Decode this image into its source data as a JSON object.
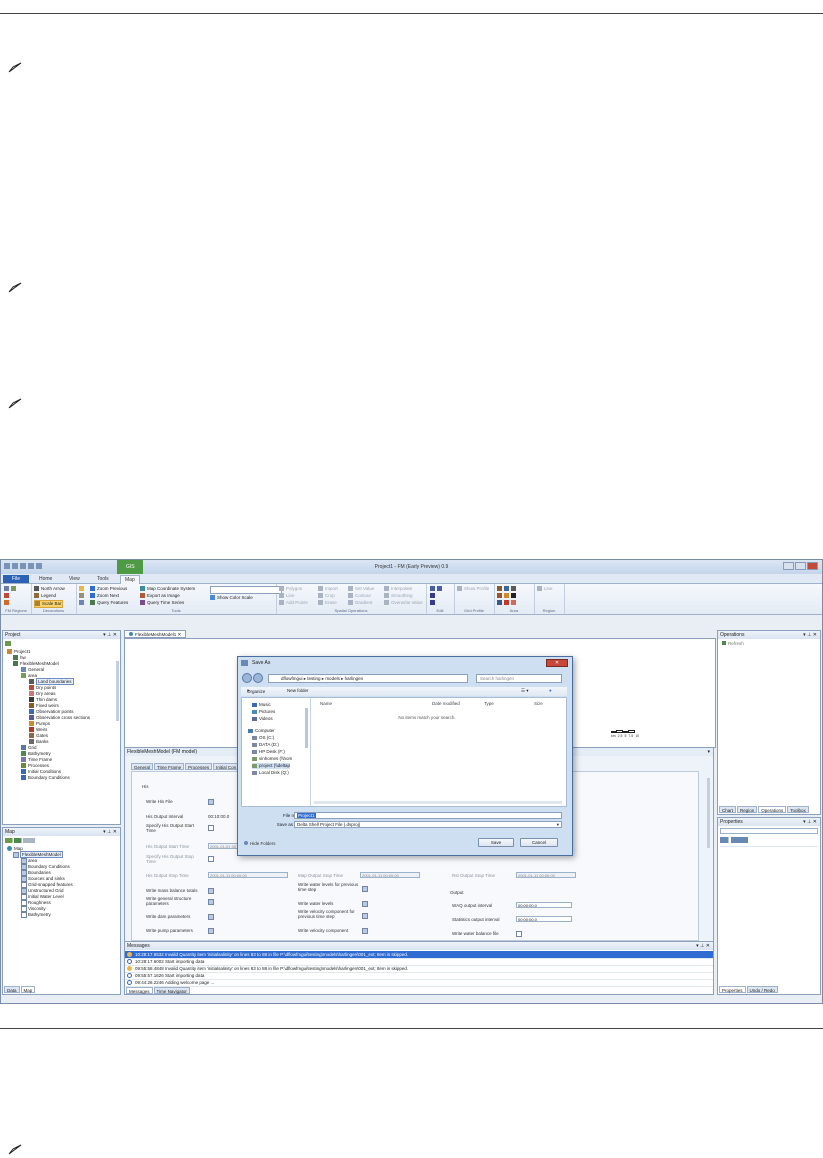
{
  "app": {
    "title": "Project1 - FM (Early Preview) 0.9",
    "context_tab": "GIS",
    "file_tab": "File",
    "ribbon_tabs": [
      "Home",
      "View",
      "Tools",
      "Map"
    ],
    "active_tab": "Map"
  },
  "ribbon": {
    "fm_regions": {
      "label": "FM Regions"
    },
    "decorations": {
      "label": "Decorations",
      "items": [
        "North Arrow",
        "Legend",
        "Scale Bar"
      ]
    },
    "tools": {
      "label": "Tools",
      "items": [
        "Zoom Previous",
        "Zoom Next",
        "Query Features",
        "Map Coordinate System",
        "Export as Image",
        "Query Time Series",
        "Show Color Scale"
      ]
    },
    "spatial_operations": {
      "label": "Spatial Operations",
      "items": [
        "Polygon",
        "Line",
        "Add Points",
        "Import",
        "Crop",
        "Erase",
        "Set Value",
        "Contour",
        "Gradient",
        "Interpolate",
        "Smoothing",
        "Overwrite Value"
      ]
    },
    "edit": {
      "label": "Edit"
    },
    "grid_profile": {
      "label": "Grid Profile",
      "items": [
        "Show Profile"
      ]
    },
    "area": {
      "label": "Area"
    },
    "region": {
      "label": "Region",
      "items": [
        "Line"
      ]
    }
  },
  "project_pane": {
    "title": "Project",
    "tree": [
      "Project1",
      "hw",
      "FlexibleMeshModel",
      "General",
      "area",
      "Land boundaries",
      "Dry points",
      "Dry areas",
      "Thin dams",
      "Fixed weirs",
      "Observation points",
      "Observation cross sections",
      "Pumps",
      "Weirs",
      "Gates",
      "Banks",
      "Grid",
      "Bathymetry",
      "Time Frame",
      "Processes",
      "Initial Conditions",
      "Boundary Conditions"
    ],
    "selected": "Land boundaries"
  },
  "map_pane": {
    "title": "Map",
    "tree": [
      "Map",
      "FlexibleMeshModel",
      "area",
      "Boundary Conditions",
      "Boundaries",
      "Sources and sinks",
      "Grid-snapped features",
      "Unstructured Grid",
      "Initial Water Level",
      "Roughness",
      "Viscosity",
      "Bathymetry"
    ],
    "bottom_tabs": [
      "Data",
      "Map"
    ]
  },
  "document": {
    "tab": "FlexibleMeshModel1",
    "scale_labels": [
      "km",
      "2.5",
      "5",
      "7.5",
      "10"
    ],
    "sub_title": "FlexibleMeshModel (FM model)",
    "sub_tabs": [
      "General",
      "Time Frame",
      "Processes",
      "Initial Con"
    ],
    "section_his": "His",
    "fields": {
      "write_his_file": "Write His File",
      "his_output_interval": "His Output Interval",
      "his_output_interval_value": "00:10:00.0",
      "specify_his_start": "Specify His Output Start Time",
      "his_start_time": "His Output Start Time",
      "his_start_value": "2001-01-01 00",
      "specify_his_stop": "Specify His Output Stop Time",
      "his_stop_time": "His Output Stop Time",
      "his_stop_value": "2001-01-11 00:00:00",
      "map_stop_time": "Map Output Stop Time",
      "map_stop_value": "2001-01-11 00:00:00",
      "rst_stop_time": "Rst Output Stop Time",
      "rst_stop_value": "2001-01-11 00:00:00",
      "write_mass_balance": "Write mass balance totals",
      "write_general_structure": "Write general structure parameters",
      "write_dam": "Write dam parameters",
      "write_pump": "Write pump parameters",
      "write_water_levels_prev": "Write water levels for previous time step",
      "write_water_levels": "Write water levels",
      "write_velocity_prev": "Write velocity component for previous time step",
      "write_velocity": "Write velocity component",
      "output": "Output",
      "waq_interval": "WAQ output interval",
      "waq_value": "00:00:00.0",
      "stats_interval": "Statistics output interval",
      "stats_value": "00:00:00.0",
      "write_water_balance": "Write water balance file"
    }
  },
  "messages": {
    "title": "Messages",
    "rows": [
      {
        "time": "10:28:17.6532",
        "text": "Invalid Quantity item 'initialsalinity' on lines 83 to 88 in file P:\\dflowfmgui\\testing\\models\\harlingen\\001_ext; Item is skipped.",
        "level": "warn"
      },
      {
        "time": "10:28:17.6002",
        "text": "Start importing data",
        "level": "info"
      },
      {
        "time": "09:55:58.4848",
        "text": "Invalid Quantity item 'initialsalinity' on lines 83 to 88 in file P:\\dflowfmgui\\testing\\models\\harlingen\\001_ext; Item is skipped.",
        "level": "warn"
      },
      {
        "time": "09:55:57.1626",
        "text": "Start importing data",
        "level": "info"
      },
      {
        "time": "09:44:28.2246",
        "text": "Adding welcome page ...",
        "level": "info"
      }
    ],
    "bottom_tabs": [
      "Messages",
      "Time Navigator"
    ]
  },
  "operations_pane": {
    "title": "Operations",
    "refresh": "Refresh",
    "tabs": [
      "Chart",
      "Region",
      "Operations",
      "Toolbox"
    ]
  },
  "properties_pane": {
    "title": "Properties",
    "tabs": [
      "Properties",
      "Undo / Redo"
    ]
  },
  "save_dialog": {
    "title": "Save As",
    "path": [
      "dflowfmgui",
      "testing",
      "models",
      "harlingen"
    ],
    "search_placeholder": "Search harlingen",
    "organize": "Organize",
    "new_folder": "New folder",
    "nav": [
      "Music",
      "Pictures",
      "Videos",
      "Computer",
      "OS (C:)",
      "DATA (D:)",
      "HP Desk (F:)",
      "vinhomes (\\\\hom",
      "project (\\\\deltap",
      "Local Disk (Q:)"
    ],
    "columns": [
      "Name",
      "Date modified",
      "Type",
      "Size"
    ],
    "empty_text": "No items match your search.",
    "file_name_label": "File name:",
    "file_name_value": "Project1",
    "save_type_label": "Save as type:",
    "save_type_value": "Delta Shell Project File (.dsproj)",
    "hide_folders": "Hide Folders",
    "save": "Save",
    "cancel": "Cancel"
  }
}
